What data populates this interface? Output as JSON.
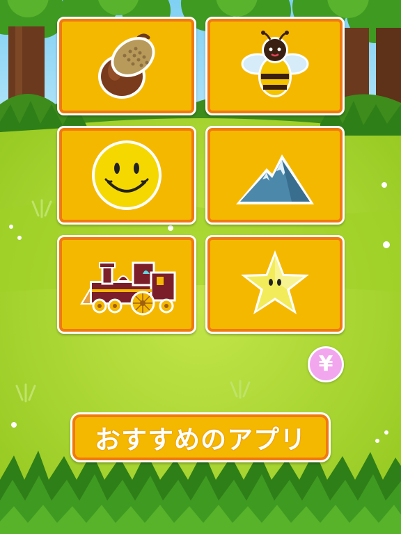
{
  "menu": {
    "tiles": [
      {
        "icon": "acorn-icon"
      },
      {
        "icon": "bee-icon"
      },
      {
        "icon": "smiley-face-icon"
      },
      {
        "icon": "mountain-icon"
      },
      {
        "icon": "train-icon"
      },
      {
        "icon": "star-icon"
      }
    ]
  },
  "purchase_button": {
    "symbol": "¥",
    "icon": "yen-icon"
  },
  "recommend_button": {
    "label": "おすすめのアプリ"
  },
  "colors": {
    "tile_fill": "#f5b800",
    "tile_border": "#f07a10",
    "grass": "#a6d62a",
    "sky": "#6fc6f0",
    "yen_button": "#f2a6ee"
  }
}
